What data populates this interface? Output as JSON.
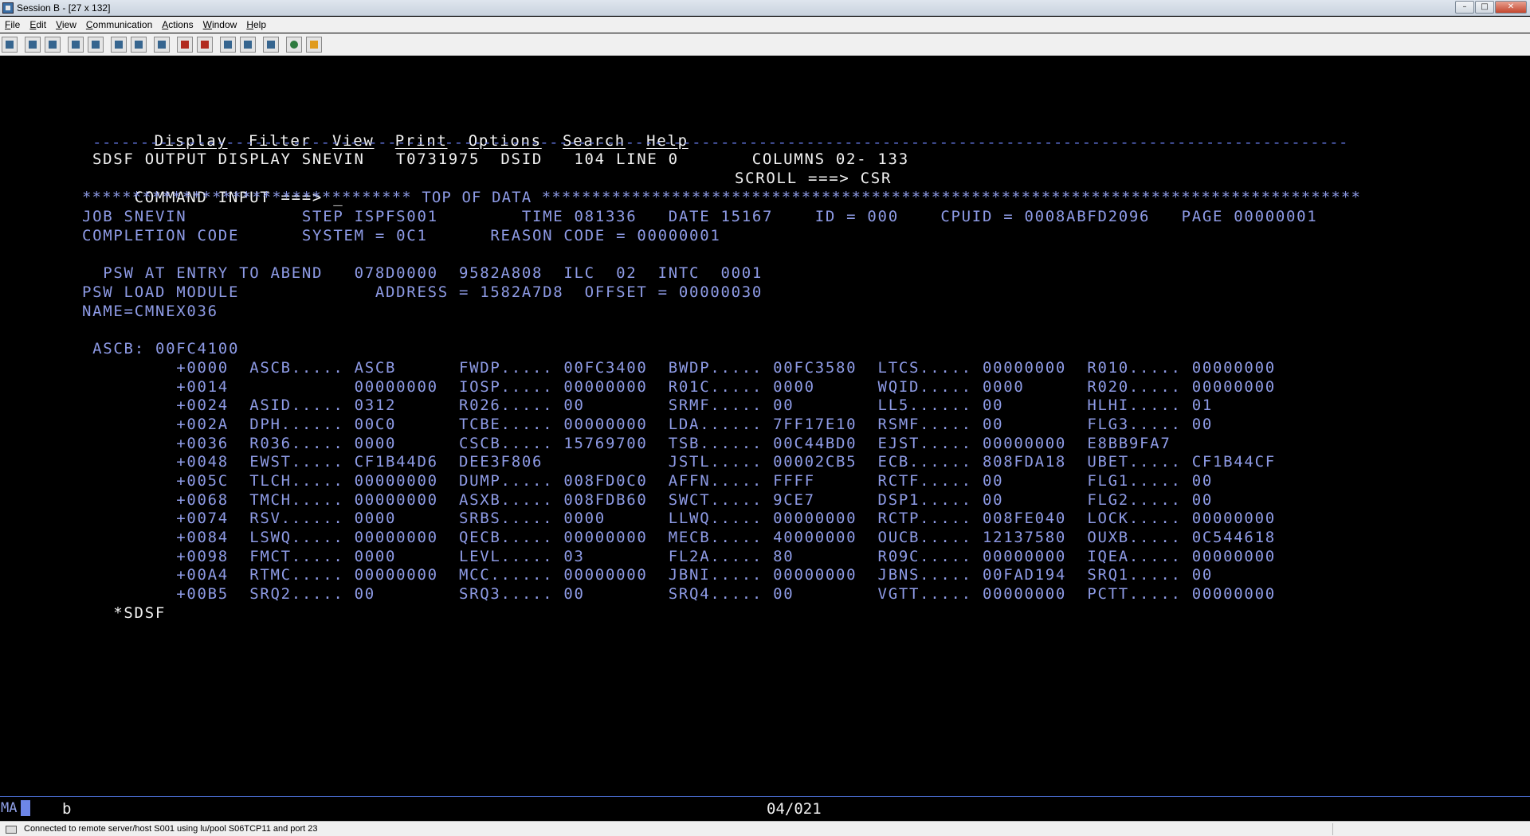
{
  "window": {
    "title": "Session B - [27 x 132]",
    "controls": {
      "minimize": "–",
      "maximize": "□",
      "close": "✕"
    }
  },
  "menubar": [
    "File",
    "Edit",
    "View",
    "Communication",
    "Actions",
    "Window",
    "Help"
  ],
  "toolbar_icons": [
    "print-screen-icon",
    "copy-icon",
    "paste-icon",
    "send-file-icon",
    "receive-file-icon",
    "display-keypad-icon",
    "macro-icon",
    "record-macro-icon",
    "play-macro-icon",
    "stop-macro-icon",
    "customize-icon",
    "preferences-icon",
    "color-icon",
    "connect-icon",
    "disconnect-icon",
    "help-icon"
  ],
  "terminal": {
    "action_menu": [
      "Display",
      "Filter",
      "View",
      "Print",
      "Options",
      "Search",
      "Help"
    ],
    "separator": "------------------------------------------------------------------------------------------------------------------------------------",
    "header_line": "SDSF OUTPUT DISPLAY SNEVIN   T0731975  DSID   104 LINE 0       COLUMNS 02- 133",
    "command_prompt": "COMMAND INPUT ===> ",
    "cursor": "_",
    "scroll_text": "SCROLL ===> CSR",
    "top_of_data": "********************************* TOP OF DATA **********************************************************************************",
    "job_line": "JOB SNEVIN           STEP ISPFS001        TIME 081336   DATE 15167    ID = 000    CPUID = 0008ABFD2096   PAGE 00000001",
    "completion_line": "COMPLETION CODE      SYSTEM = 0C1      REASON CODE = 00000001",
    "psw_entry_line": "  PSW AT ENTRY TO ABEND   078D0000  9582A808  ILC  02  INTC  0001",
    "psw_load_line": "PSW LOAD MODULE             ADDRESS = 1582A7D8  OFFSET = 00000030",
    "name_line": "NAME=CMNEX036",
    "ascb_line": " ASCB: 00FC4100",
    "ascb_rows": [
      "         +0000  ASCB..... ASCB      FWDP..... 00FC3400  BWDP..... 00FC3580  LTCS..... 00000000  R010..... 00000000",
      "         +0014            00000000  IOSP..... 00000000  R01C..... 0000      WQID..... 0000      R020..... 00000000",
      "         +0024  ASID..... 0312      R026..... 00        SRMF..... 00        LL5...... 00        HLHI..... 01",
      "         +002A  DPH...... 00C0      TCBE..... 00000000  LDA...... 7FF17E10  RSMF..... 00        FLG3..... 00",
      "         +0036  R036..... 0000      CSCB..... 15769700  TSB...... 00C44BD0  EJST..... 00000000  E8BB9FA7",
      "         +0048  EWST..... CF1B44D6  DEE3F806            JSTL..... 00002CB5  ECB...... 808FDA18  UBET..... CF1B44CF",
      "         +005C  TLCH..... 00000000  DUMP..... 008FD0C0  AFFN..... FFFF      RCTF..... 00        FLG1..... 00",
      "         +0068  TMCH..... 00000000  ASXB..... 008FDB60  SWCT..... 9CE7      DSP1..... 00        FLG2..... 00",
      "         +0074  RSV...... 0000      SRBS..... 0000      LLWQ..... 00000000  RCTP..... 008FE040  LOCK..... 00000000",
      "         +0084  LSWQ..... 00000000  QECB..... 00000000  MECB..... 40000000  OUCB..... 12137580  OUXB..... 0C544618",
      "         +0098  FMCT..... 0000      LEVL..... 03        FL2A..... 80        R09C..... 00000000  IQEA..... 00000000",
      "         +00A4  RTMC..... 00000000  MCC...... 00000000  JBNI..... 00000000  JBNS..... 00FAD194  SRQ1..... 00",
      "         +00B5  SRQ2..... 00        SRQ3..... 00        SRQ4..... 00        VGTT..... 00000000  PCTT..... 00000000"
    ],
    "footer_mark": "  *SDSF"
  },
  "oia": {
    "mode": "MA",
    "indicator": "b",
    "cursor_position": "04/021"
  },
  "statusbar": {
    "message": "Connected to remote server/host S001 using lu/pool S06TCP11 and port 23"
  },
  "colors": {
    "screen_background": "#000000",
    "field_blue": "#8e9be6",
    "field_white": "#f2f2f2",
    "separator_blue": "#5e72d9",
    "oia_line": "#4b6fd6"
  }
}
